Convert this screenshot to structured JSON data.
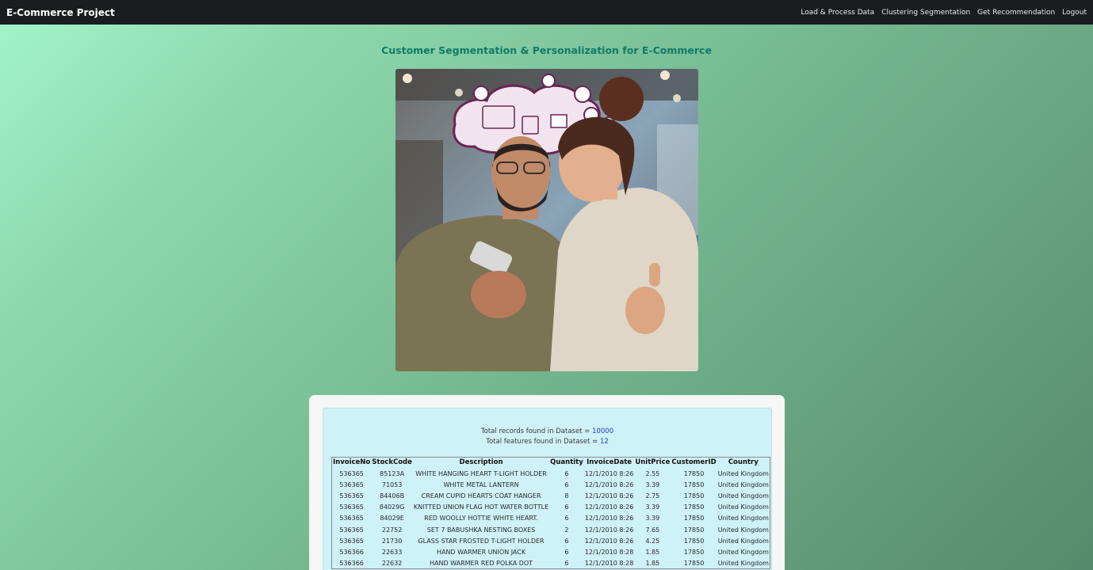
{
  "navbar": {
    "brand": "E-Commerce Project",
    "links": [
      "Load & Process Data",
      "Clustering Segmentation",
      "Get Recommendation",
      "Logout"
    ]
  },
  "page_title": "Customer Segmentation & Personalization for E-Commerce",
  "stats": {
    "records_label": "Total records found in Dataset = ",
    "records_value": "10000",
    "features_label": "Total features found in Dataset = ",
    "features_value": "12"
  },
  "table": {
    "headers": [
      "InvoiceNo",
      "StockCode",
      "Description",
      "Quantity",
      "InvoiceDate",
      "UnitPrice",
      "CustomerID",
      "Country"
    ],
    "rows": [
      [
        "536365",
        "85123A",
        "WHITE HANGING HEART T-LIGHT HOLDER",
        "6",
        "12/1/2010 8:26",
        "2.55",
        "17850",
        "United Kingdom"
      ],
      [
        "536365",
        "71053",
        "WHITE METAL LANTERN",
        "6",
        "12/1/2010 8:26",
        "3.39",
        "17850",
        "United Kingdom"
      ],
      [
        "536365",
        "84406B",
        "CREAM CUPID HEARTS COAT HANGER",
        "8",
        "12/1/2010 8:26",
        "2.75",
        "17850",
        "United Kingdom"
      ],
      [
        "536365",
        "84029G",
        "KNITTED UNION FLAG HOT WATER BOTTLE",
        "6",
        "12/1/2010 8:26",
        "3.39",
        "17850",
        "United Kingdom"
      ],
      [
        "536365",
        "84029E",
        "RED WOOLLY HOTTIE WHITE HEART.",
        "6",
        "12/1/2010 8:26",
        "3.39",
        "17850",
        "United Kingdom"
      ],
      [
        "536365",
        "22752",
        "SET 7 BABUSHKA NESTING BOXES",
        "2",
        "12/1/2010 8:26",
        "7.65",
        "17850",
        "United Kingdom"
      ],
      [
        "536365",
        "21730",
        "GLASS STAR FROSTED T-LIGHT HOLDER",
        "6",
        "12/1/2010 8:26",
        "4.25",
        "17850",
        "United Kingdom"
      ],
      [
        "536366",
        "22633",
        "HAND WARMER UNION JACK",
        "6",
        "12/1/2010 8:28",
        "1.85",
        "17850",
        "United Kingdom"
      ],
      [
        "536366",
        "22632",
        "HAND WARMER RED POLKA DOT",
        "6",
        "12/1/2010 8:28",
        "1.85",
        "17850",
        "United Kingdom"
      ]
    ]
  }
}
